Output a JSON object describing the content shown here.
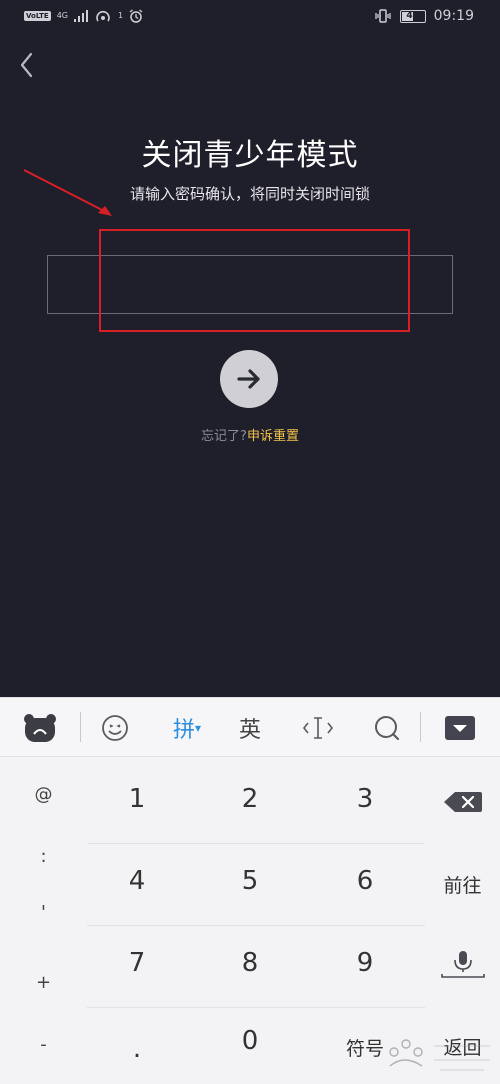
{
  "status_bar": {
    "volte": "VoLTE",
    "network": "4G",
    "wifi_badge": "1",
    "battery": "47",
    "time": "09:19"
  },
  "header": {
    "title": "关闭青少年模式",
    "subtitle": "请输入密码确认，将同时关闭时间锁"
  },
  "password_input": {
    "value": "",
    "placeholder": ""
  },
  "forgot": {
    "question": "忘记了?",
    "link": "申诉重置"
  },
  "keyboard": {
    "toolbar": {
      "pinyin": "拼",
      "english": "英"
    },
    "symbols": [
      "@",
      ":",
      "'",
      "+",
      "-"
    ],
    "digits": [
      "1",
      "2",
      "3",
      "4",
      "5",
      "6",
      "7",
      "8",
      "9",
      ".",
      "0"
    ],
    "fuhao": "符号",
    "enter": "前往",
    "return": "返回"
  },
  "colors": {
    "background": "#1f1e2b",
    "link": "#f1c24a",
    "annotation": "#d81f26",
    "pinyin_accent": "#2a8fe0"
  }
}
